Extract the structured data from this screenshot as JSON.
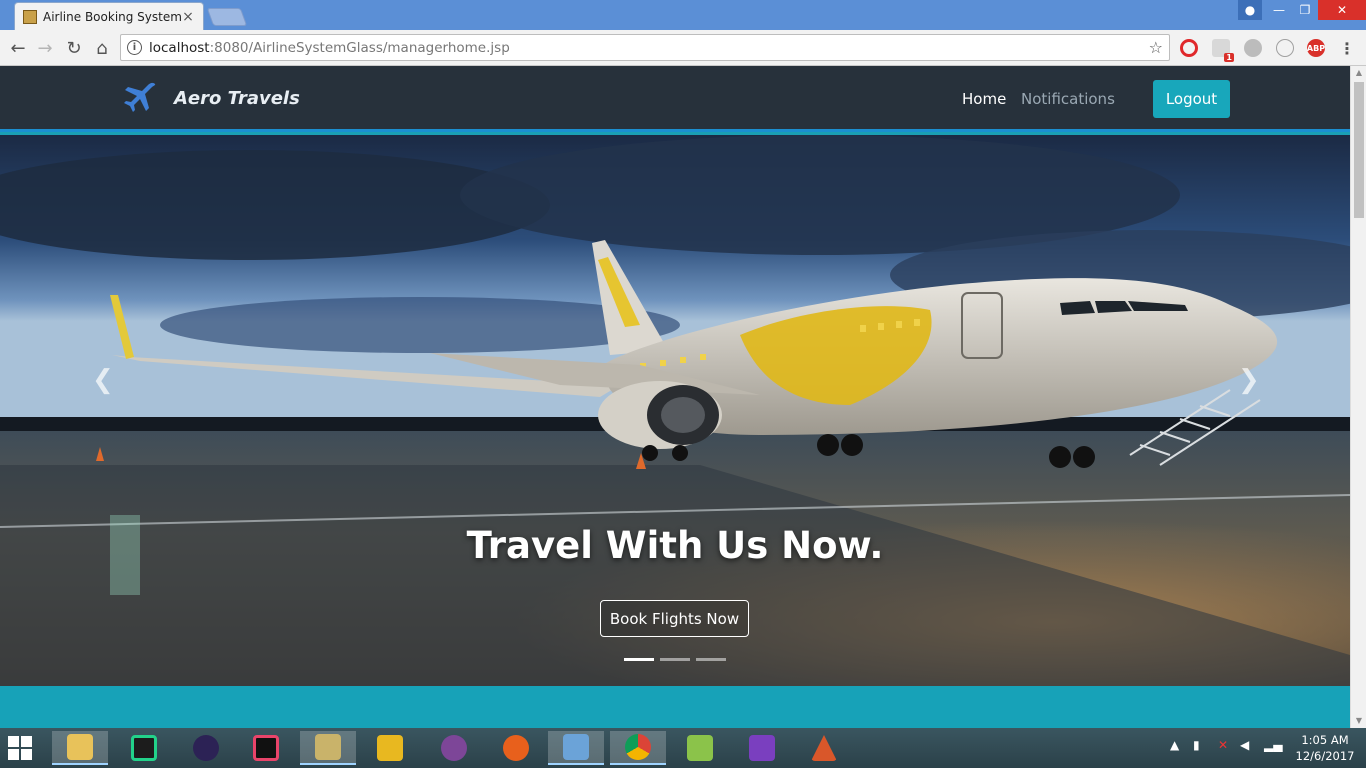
{
  "browser": {
    "tab_title": "Airline Booking System",
    "tab_close": "×",
    "url_host": "localhost",
    "url_path": ":8080/AirlineSystemGlass/managerhome.jsp",
    "ext_abp": "ABP",
    "ext_badge": "1"
  },
  "site": {
    "brand": "Aero Travels",
    "nav": {
      "home": "Home",
      "notifications": "Notifications"
    },
    "logout": "Logout"
  },
  "hero": {
    "caption": "Travel With Us Now.",
    "cta": "Book Flights Now",
    "prev_glyph": "❮",
    "next_glyph": "❯",
    "slide_count": 3,
    "active_slide": 1
  },
  "taskbar": {
    "time": "1:05 AM",
    "date": "12/6/2017",
    "apps": [
      "file-explorer",
      "pycharm",
      "eclipse",
      "intellij",
      "tool",
      "sublime-like",
      "tor-browser",
      "firefox",
      "virtualbox",
      "chrome",
      "notepad++",
      "visual-studio",
      "matlab"
    ]
  },
  "colors": {
    "accent": "#17a2b8",
    "header_bg": "#27313b",
    "titlebar": "#5b8fd6"
  }
}
